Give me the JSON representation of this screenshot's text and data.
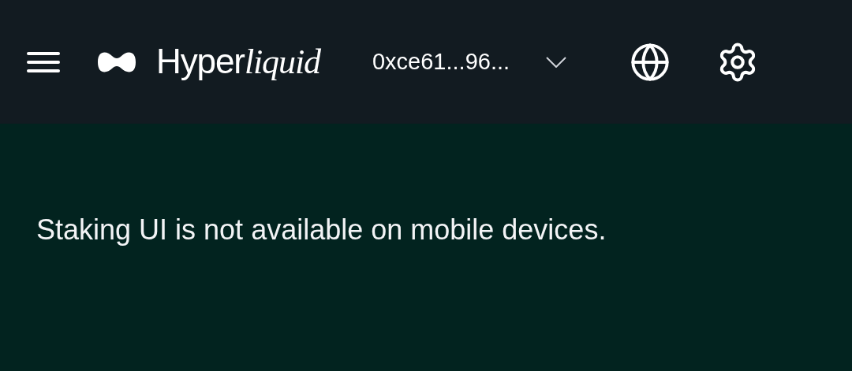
{
  "header": {
    "brand": {
      "plain_part": "Hyper",
      "italic_part": "liquid"
    },
    "account": "0xce61...96..."
  },
  "message": "Staking UI is not available on mobile devices."
}
